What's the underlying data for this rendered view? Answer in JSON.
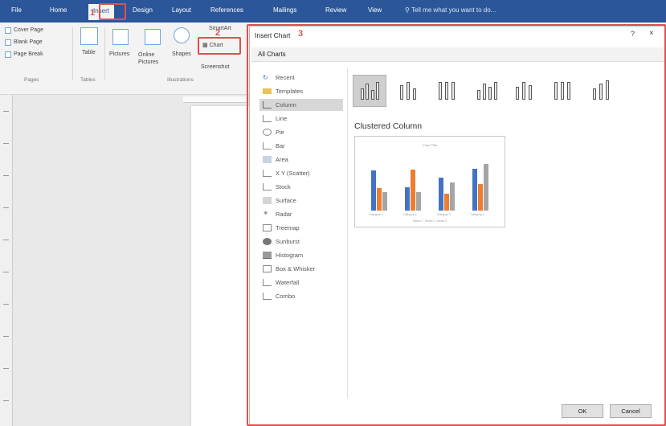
{
  "tabs": [
    "File",
    "Home",
    "Insert",
    "Design",
    "Layout",
    "References",
    "Mailings",
    "Review",
    "View"
  ],
  "tell_me": "Tell me what you want to do...",
  "ribbon": {
    "cover_page": "Cover Page",
    "blank_page": "Blank Page",
    "page_break": "Page Break",
    "table": "Table",
    "pictures": "Pictures",
    "online_pictures": "Online Pictures",
    "shapes": "Shapes",
    "smartart": "SmartArt",
    "chart": "Chart",
    "screenshot": "Screenshot",
    "groups": {
      "pages": "Pages",
      "tables": "Tables",
      "illustrations": "Illustrations"
    }
  },
  "dialog": {
    "title": "Insert Chart",
    "help": "?",
    "close": "×",
    "tab_all": "All Charts",
    "categories": [
      "Recent",
      "Templates",
      "Column",
      "Line",
      "Pie",
      "Bar",
      "Area",
      "X Y (Scatter)",
      "Stock",
      "Surface",
      "Radar",
      "Treemap",
      "Sunburst",
      "Histogram",
      "Box & Whisker",
      "Waterfall",
      "Combo"
    ],
    "selected_category": "Column",
    "subtype_title": "Clustered Column",
    "ok": "OK",
    "cancel": "Cancel"
  },
  "chart_data": {
    "type": "bar",
    "title": "Chart Title",
    "categories": [
      "Category 1",
      "Category 2",
      "Category 3",
      "Category 4"
    ],
    "series": [
      {
        "name": "Series 1",
        "values": [
          4.3,
          2.5,
          3.5,
          4.5
        ]
      },
      {
        "name": "Series 2",
        "values": [
          2.4,
          4.4,
          1.8,
          2.8
        ]
      },
      {
        "name": "Series 3",
        "values": [
          2,
          2,
          3,
          5
        ]
      }
    ],
    "ylim": [
      0,
      6
    ],
    "colors": [
      "#4472c4",
      "#ed7d31",
      "#a5a5a5"
    ],
    "legend": "bottom"
  },
  "annotations": {
    "step1": "1",
    "step2": "2",
    "step3": "3"
  },
  "colors": {
    "accent": "#2b579a",
    "highlight": "#d9534f"
  }
}
